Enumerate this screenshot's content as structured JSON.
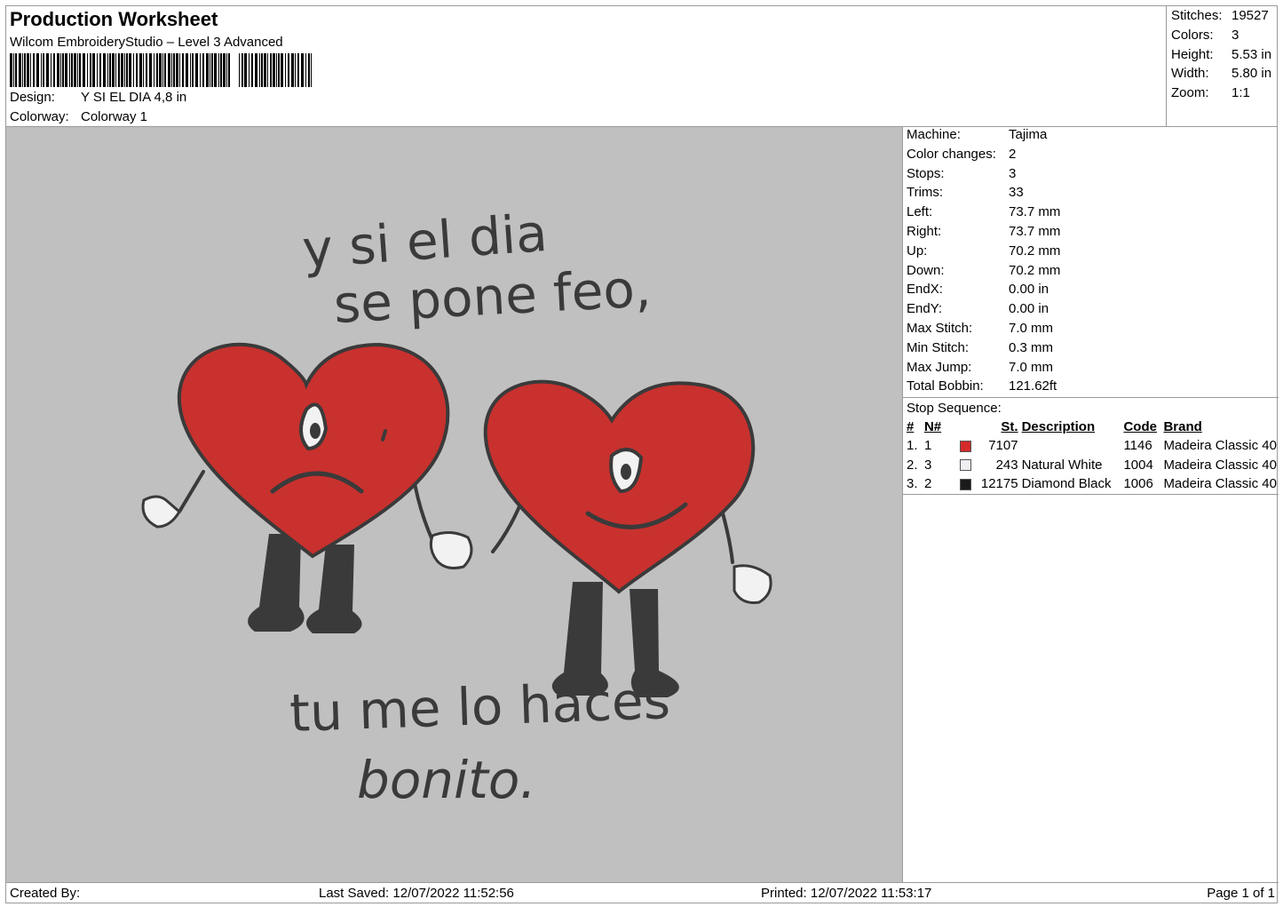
{
  "header": {
    "title": "Production Worksheet",
    "subtitle": "Wilcom EmbroideryStudio – Level 3 Advanced",
    "design_label": "Design:",
    "design_value": "Y SI EL DIA 4,8 in",
    "colorway_label": "Colorway:",
    "colorway_value": "Colorway 1"
  },
  "summary": [
    {
      "k": "Stitches:",
      "v": "19527"
    },
    {
      "k": "Colors:",
      "v": "3"
    },
    {
      "k": "Height:",
      "v": "5.53 in"
    },
    {
      "k": "Width:",
      "v": "5.80 in"
    },
    {
      "k": "Zoom:",
      "v": "1:1"
    }
  ],
  "info": [
    {
      "k": "Machine:",
      "v": "Tajima"
    },
    {
      "k": "Color changes:",
      "v": "2"
    },
    {
      "k": "Stops:",
      "v": "3"
    },
    {
      "k": "Trims:",
      "v": "33"
    },
    {
      "k": "Left:",
      "v": "73.7 mm"
    },
    {
      "k": "Right:",
      "v": "73.7 mm"
    },
    {
      "k": "Up:",
      "v": "70.2 mm"
    },
    {
      "k": "Down:",
      "v": "70.2 mm"
    },
    {
      "k": "EndX:",
      "v": "0.00 in"
    },
    {
      "k": "EndY:",
      "v": "0.00 in"
    },
    {
      "k": "Max Stitch:",
      "v": "7.0 mm"
    },
    {
      "k": "Min Stitch:",
      "v": "0.3 mm"
    },
    {
      "k": "Max Jump:",
      "v": "7.0 mm"
    },
    {
      "k": "Total Bobbin:",
      "v": "121.62ft"
    }
  ],
  "stops": {
    "caption": "Stop Sequence:",
    "headers": [
      "#",
      "N#",
      "St.",
      "Description",
      "Code",
      "Brand"
    ],
    "rows": [
      {
        "idx": "1.",
        "n": "1",
        "color": "#d42a2a",
        "st": "7107",
        "desc": "",
        "code": "1146",
        "brand": "Madeira Classic 40"
      },
      {
        "idx": "2.",
        "n": "3",
        "color": "#eeeef2",
        "st": "243",
        "desc": "Natural White",
        "code": "1004",
        "brand": "Madeira Classic 40"
      },
      {
        "idx": "3.",
        "n": "2",
        "color": "#1a1a1a",
        "st": "12175",
        "desc": "Diamond Black",
        "code": "1006",
        "brand": "Madeira Classic 40"
      }
    ]
  },
  "design_text": {
    "line1": "y si el dia",
    "line2": "se pone feo,",
    "line3": "tu me lo haces",
    "line4": "bonito."
  },
  "colors": {
    "heart": "#c8312e",
    "outline": "#3a3a3a",
    "canvas": "#c0c0c0"
  },
  "footer": {
    "created": "Created By:",
    "saved": "Last Saved: 12/07/2022 11:52:56",
    "printed": "Printed: 12/07/2022 11:53:17",
    "page": "Page 1 of 1"
  }
}
